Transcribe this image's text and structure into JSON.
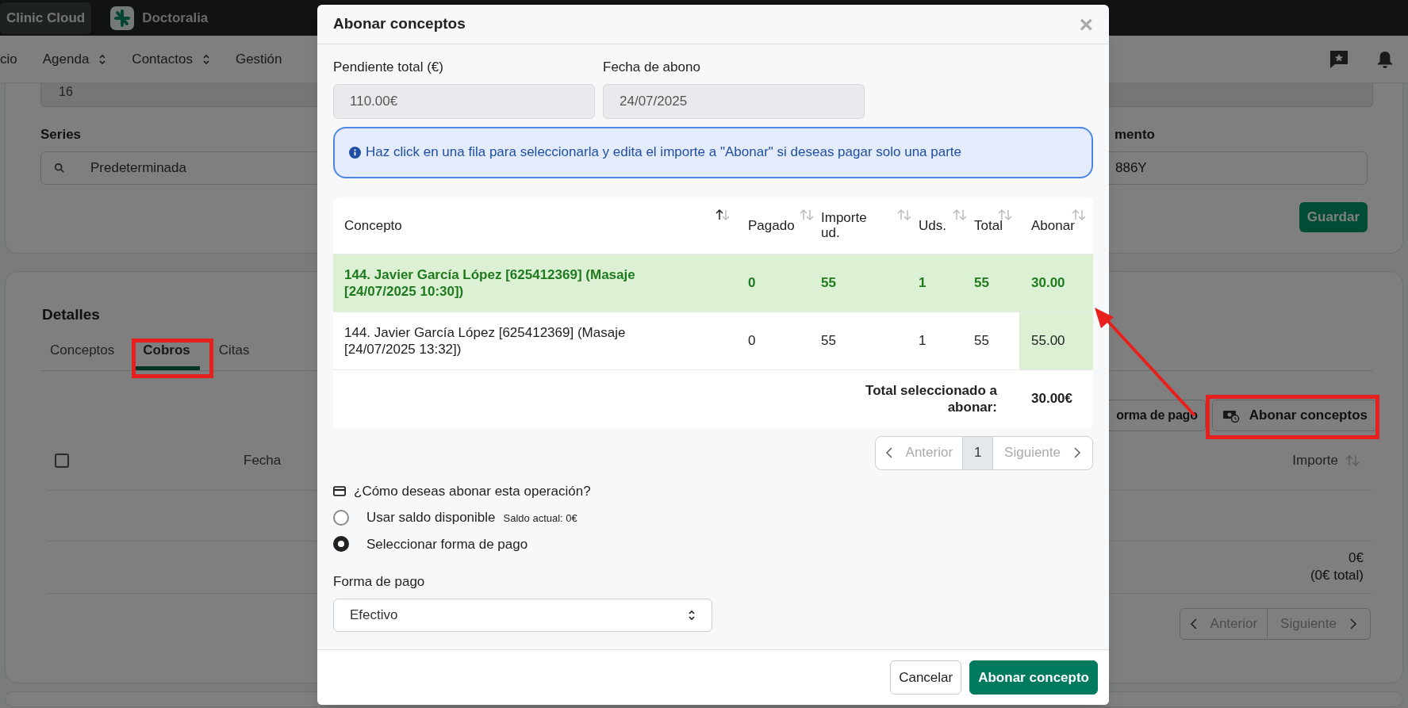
{
  "top_bar": {
    "tabs": [
      {
        "label": "Clinic Cloud",
        "selected": true
      },
      {
        "label": "Doctoralia",
        "selected": false
      }
    ]
  },
  "nav": {
    "items": [
      {
        "label": "cio",
        "expandable": false
      },
      {
        "label": "Agenda",
        "expandable": true
      },
      {
        "label": "Contactos",
        "expandable": true
      },
      {
        "label": "Gestión",
        "expandable": false
      }
    ]
  },
  "form_card": {
    "top_field": {
      "value": "16"
    },
    "series": {
      "label": "Series",
      "value": "Predeterminada"
    },
    "document": {
      "label": "mento",
      "value": "886Y"
    },
    "save_button": "Guardar"
  },
  "details_card": {
    "title": "Detalles",
    "tabs": [
      {
        "label": "Conceptos",
        "selected": false
      },
      {
        "label": "Cobros",
        "selected": true
      },
      {
        "label": "Citas",
        "selected": false
      }
    ],
    "buttons": [
      {
        "label": "orma de pago",
        "kind": "plain"
      },
      {
        "label": "Abonar conceptos",
        "kind": "icon"
      }
    ],
    "table": {
      "select_all_checked": false,
      "columns": [
        {
          "label": "Fecha",
          "sortable": false
        },
        {
          "label": "Importe",
          "sortable": true
        }
      ],
      "total": "0€",
      "total_note": "(0€ total)"
    },
    "pagination": {
      "previous": "Anterior",
      "next": "Siguiente"
    }
  },
  "modal": {
    "title": "Abonar conceptos",
    "close": "×",
    "pending": {
      "label": "Pendiente total (€)",
      "value": "110.00€"
    },
    "date": {
      "label": "Fecha de abono",
      "value": "24/07/2025"
    },
    "info": "Haz click en una fila para seleccionarla y edita el importe a \"Abonar\" si deseas pagar solo una parte",
    "table": {
      "columns": [
        {
          "label": "Concepto",
          "sorted": true
        },
        {
          "label": "Pagado",
          "sorted": false
        },
        {
          "label": "Importe ud.",
          "sorted": false
        },
        {
          "label": "Uds.",
          "sorted": false
        },
        {
          "label": "Total",
          "sorted": false
        },
        {
          "label": "Abonar",
          "sorted": false
        }
      ],
      "rows": [
        {
          "selected": true,
          "cells": [
            "144. Javier García López [625412369] (Masaje [24/07/2025 10:30])",
            "0",
            "55",
            "1",
            "55",
            "30.00"
          ]
        },
        {
          "selected": false,
          "cells": [
            "144. Javier García López [625412369] (Masaje [24/07/2025 13:32])",
            "0",
            "55",
            "1",
            "55",
            "55.00"
          ]
        }
      ],
      "total_label": "Total seleccionado a abonar:",
      "total_value": "30.00€"
    },
    "pagination": {
      "previous": "Anterior",
      "pages": [
        {
          "label": "1",
          "selected": true
        }
      ],
      "next": "Siguiente"
    },
    "question": "¿Cómo deseas abonar esta operación?",
    "options": [
      {
        "label": "Usar saldo disponible",
        "note": "Saldo actual: 0€",
        "selected": false
      },
      {
        "label": "Seleccionar forma de pago",
        "selected": true
      }
    ],
    "payment": {
      "label": "Forma de pago",
      "value": "Efectivo"
    },
    "buttons": [
      {
        "label": "Cancelar",
        "kind": "secondary"
      },
      {
        "label": "Abonar concepto",
        "kind": "primary"
      }
    ]
  },
  "annotations": [
    {
      "kind": "box"
    },
    {
      "kind": "box"
    },
    {
      "kind": "arrow"
    }
  ]
}
